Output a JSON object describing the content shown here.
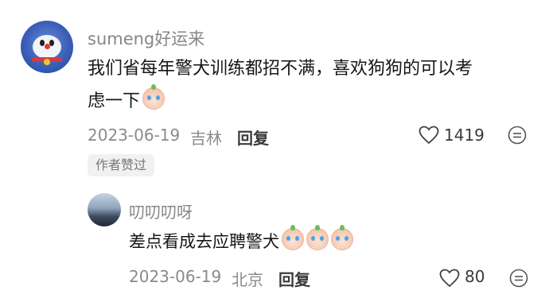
{
  "comment": {
    "username": "sumeng好运来",
    "text_line1": "我们省每年警犬训练都招不满，喜欢狗狗的可以考",
    "text_line2": "虑一下",
    "date": "2023-06-19",
    "location": "吉林",
    "reply_label": "回复",
    "likes": "1419",
    "author_badge": "作者赞过",
    "emoji_icon": "crying-face-emoji"
  },
  "reply": {
    "username": "叨叨叨呀",
    "text": "差点看成去应聘警犬",
    "emoji_count": 3,
    "date": "2023-06-19",
    "location": "北京",
    "reply_label": "回复",
    "likes": "80"
  },
  "colors": {
    "text_primary": "#161616",
    "text_secondary": "#878787",
    "badge_bg": "#f1f1f1"
  }
}
